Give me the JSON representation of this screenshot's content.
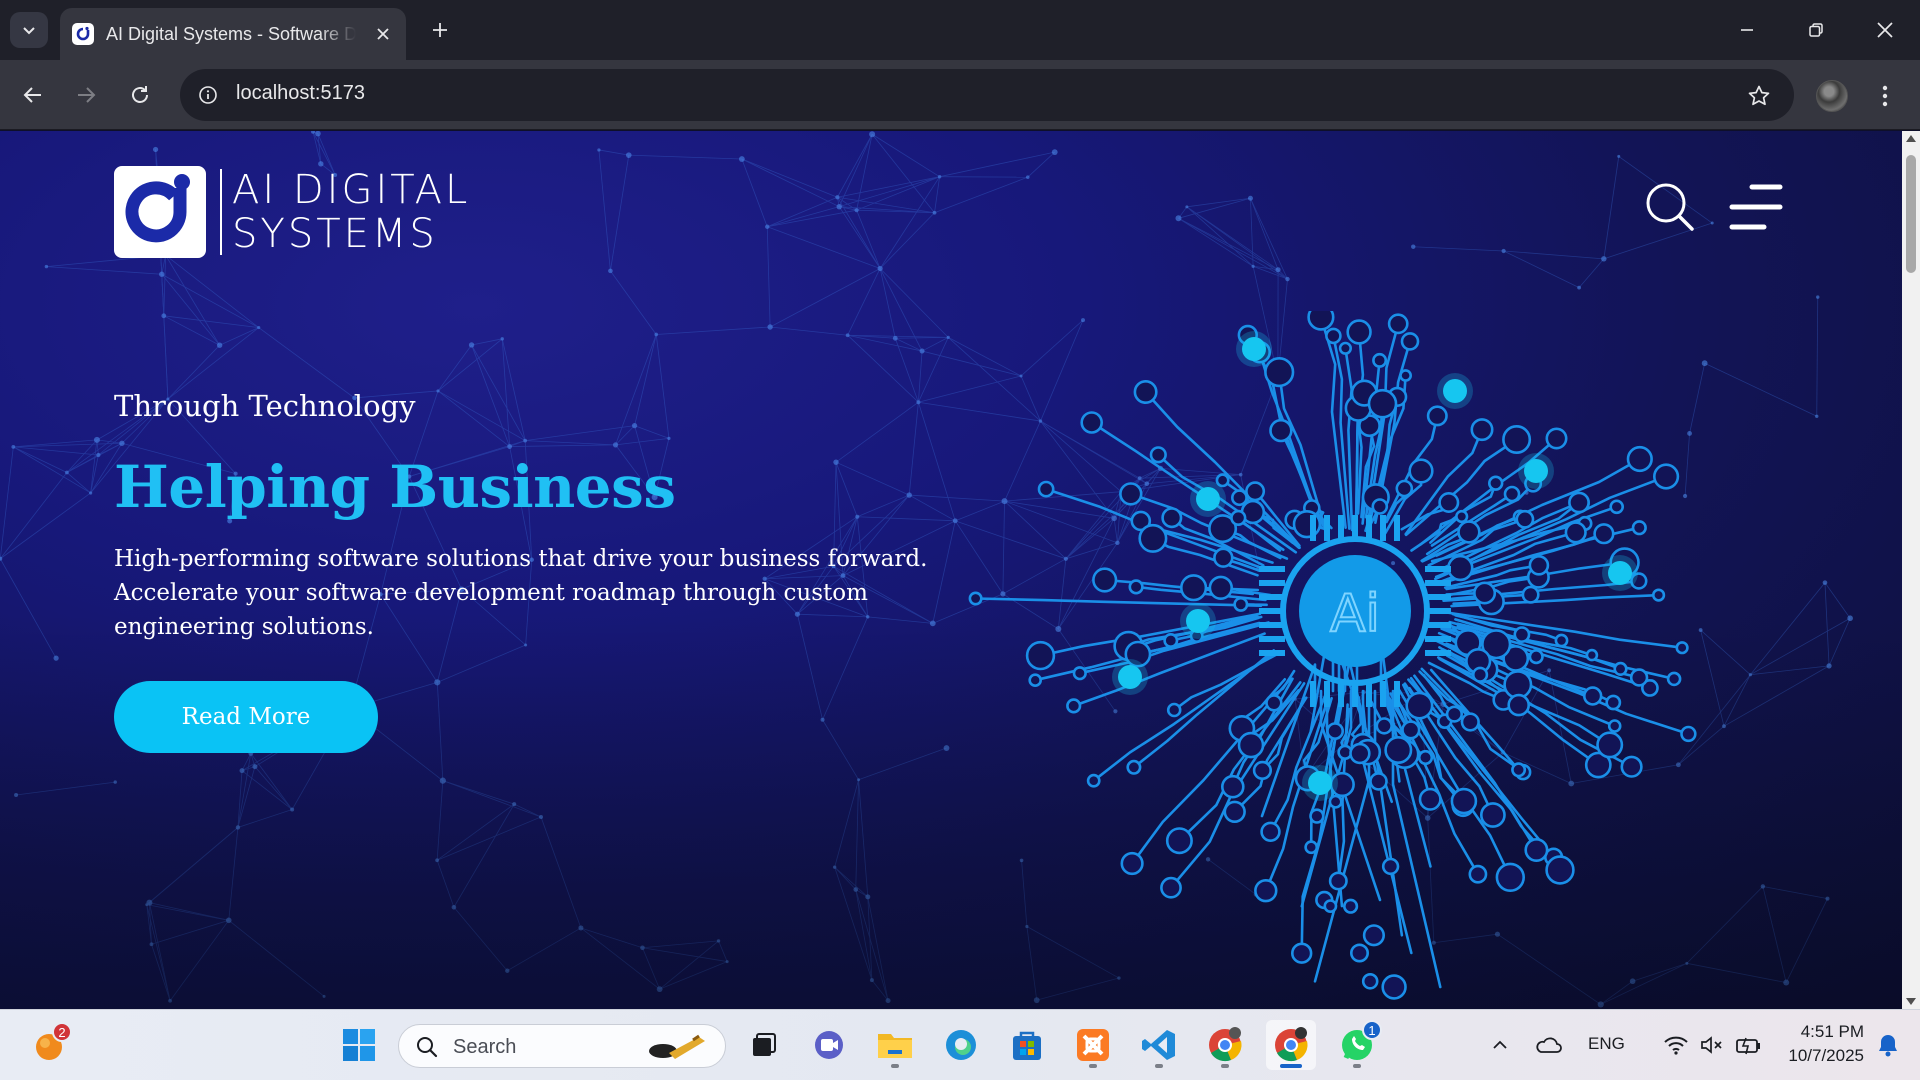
{
  "browser": {
    "tab_title": "AI Digital Systems - Software Development",
    "url": "localhost:5173"
  },
  "site": {
    "logo_text_line1": "AI DIGITAL",
    "logo_text_line2": "SYSTEMS",
    "hero": {
      "kicker": "Through Technology",
      "headline": "Helping Business",
      "description": "High-performing software solutions that drive your business forward. Accelerate your software development roadmap through custom engineering solutions.",
      "cta_label": "Read More"
    },
    "chip_label": "Ai",
    "colors": {
      "accent": "#20c0f4",
      "button": "#0ac3f5",
      "background": "#17187a",
      "circuit": "#1a8fe8"
    }
  },
  "taskbar": {
    "search_placeholder": "Search",
    "widgets_badge": "2",
    "whatsapp_badge": "1",
    "language": "ENG",
    "time": "4:51 PM",
    "date": "10/7/2025",
    "icons": [
      "weather-widget-icon",
      "windows-start-icon",
      "search-icon",
      "task-view-icon",
      "teams-icon",
      "file-explorer-icon",
      "edge-icon",
      "microsoft-store-icon",
      "xampp-icon",
      "vscode-icon",
      "chrome-icon",
      "chrome-profile-icon",
      "whatsapp-icon"
    ]
  }
}
